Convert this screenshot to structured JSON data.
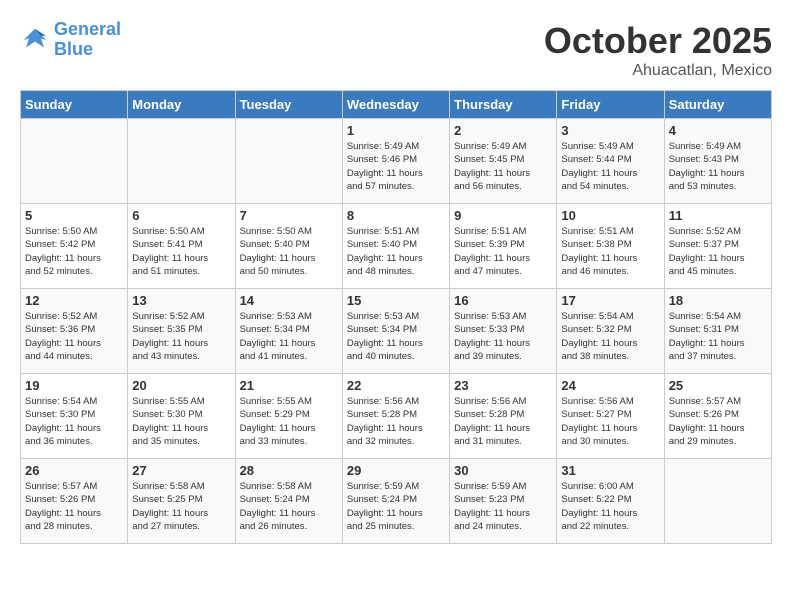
{
  "header": {
    "logo_line1": "General",
    "logo_line2": "Blue",
    "month": "October 2025",
    "location": "Ahuacatlan, Mexico"
  },
  "days_of_week": [
    "Sunday",
    "Monday",
    "Tuesday",
    "Wednesday",
    "Thursday",
    "Friday",
    "Saturday"
  ],
  "weeks": [
    [
      {
        "day": "",
        "content": ""
      },
      {
        "day": "",
        "content": ""
      },
      {
        "day": "",
        "content": ""
      },
      {
        "day": "1",
        "content": "Sunrise: 5:49 AM\nSunset: 5:46 PM\nDaylight: 11 hours\nand 57 minutes."
      },
      {
        "day": "2",
        "content": "Sunrise: 5:49 AM\nSunset: 5:45 PM\nDaylight: 11 hours\nand 56 minutes."
      },
      {
        "day": "3",
        "content": "Sunrise: 5:49 AM\nSunset: 5:44 PM\nDaylight: 11 hours\nand 54 minutes."
      },
      {
        "day": "4",
        "content": "Sunrise: 5:49 AM\nSunset: 5:43 PM\nDaylight: 11 hours\nand 53 minutes."
      }
    ],
    [
      {
        "day": "5",
        "content": "Sunrise: 5:50 AM\nSunset: 5:42 PM\nDaylight: 11 hours\nand 52 minutes."
      },
      {
        "day": "6",
        "content": "Sunrise: 5:50 AM\nSunset: 5:41 PM\nDaylight: 11 hours\nand 51 minutes."
      },
      {
        "day": "7",
        "content": "Sunrise: 5:50 AM\nSunset: 5:40 PM\nDaylight: 11 hours\nand 50 minutes."
      },
      {
        "day": "8",
        "content": "Sunrise: 5:51 AM\nSunset: 5:40 PM\nDaylight: 11 hours\nand 48 minutes."
      },
      {
        "day": "9",
        "content": "Sunrise: 5:51 AM\nSunset: 5:39 PM\nDaylight: 11 hours\nand 47 minutes."
      },
      {
        "day": "10",
        "content": "Sunrise: 5:51 AM\nSunset: 5:38 PM\nDaylight: 11 hours\nand 46 minutes."
      },
      {
        "day": "11",
        "content": "Sunrise: 5:52 AM\nSunset: 5:37 PM\nDaylight: 11 hours\nand 45 minutes."
      }
    ],
    [
      {
        "day": "12",
        "content": "Sunrise: 5:52 AM\nSunset: 5:36 PM\nDaylight: 11 hours\nand 44 minutes."
      },
      {
        "day": "13",
        "content": "Sunrise: 5:52 AM\nSunset: 5:35 PM\nDaylight: 11 hours\nand 43 minutes."
      },
      {
        "day": "14",
        "content": "Sunrise: 5:53 AM\nSunset: 5:34 PM\nDaylight: 11 hours\nand 41 minutes."
      },
      {
        "day": "15",
        "content": "Sunrise: 5:53 AM\nSunset: 5:34 PM\nDaylight: 11 hours\nand 40 minutes."
      },
      {
        "day": "16",
        "content": "Sunrise: 5:53 AM\nSunset: 5:33 PM\nDaylight: 11 hours\nand 39 minutes."
      },
      {
        "day": "17",
        "content": "Sunrise: 5:54 AM\nSunset: 5:32 PM\nDaylight: 11 hours\nand 38 minutes."
      },
      {
        "day": "18",
        "content": "Sunrise: 5:54 AM\nSunset: 5:31 PM\nDaylight: 11 hours\nand 37 minutes."
      }
    ],
    [
      {
        "day": "19",
        "content": "Sunrise: 5:54 AM\nSunset: 5:30 PM\nDaylight: 11 hours\nand 36 minutes."
      },
      {
        "day": "20",
        "content": "Sunrise: 5:55 AM\nSunset: 5:30 PM\nDaylight: 11 hours\nand 35 minutes."
      },
      {
        "day": "21",
        "content": "Sunrise: 5:55 AM\nSunset: 5:29 PM\nDaylight: 11 hours\nand 33 minutes."
      },
      {
        "day": "22",
        "content": "Sunrise: 5:56 AM\nSunset: 5:28 PM\nDaylight: 11 hours\nand 32 minutes."
      },
      {
        "day": "23",
        "content": "Sunrise: 5:56 AM\nSunset: 5:28 PM\nDaylight: 11 hours\nand 31 minutes."
      },
      {
        "day": "24",
        "content": "Sunrise: 5:56 AM\nSunset: 5:27 PM\nDaylight: 11 hours\nand 30 minutes."
      },
      {
        "day": "25",
        "content": "Sunrise: 5:57 AM\nSunset: 5:26 PM\nDaylight: 11 hours\nand 29 minutes."
      }
    ],
    [
      {
        "day": "26",
        "content": "Sunrise: 5:57 AM\nSunset: 5:26 PM\nDaylight: 11 hours\nand 28 minutes."
      },
      {
        "day": "27",
        "content": "Sunrise: 5:58 AM\nSunset: 5:25 PM\nDaylight: 11 hours\nand 27 minutes."
      },
      {
        "day": "28",
        "content": "Sunrise: 5:58 AM\nSunset: 5:24 PM\nDaylight: 11 hours\nand 26 minutes."
      },
      {
        "day": "29",
        "content": "Sunrise: 5:59 AM\nSunset: 5:24 PM\nDaylight: 11 hours\nand 25 minutes."
      },
      {
        "day": "30",
        "content": "Sunrise: 5:59 AM\nSunset: 5:23 PM\nDaylight: 11 hours\nand 24 minutes."
      },
      {
        "day": "31",
        "content": "Sunrise: 6:00 AM\nSunset: 5:22 PM\nDaylight: 11 hours\nand 22 minutes."
      },
      {
        "day": "",
        "content": ""
      }
    ]
  ]
}
